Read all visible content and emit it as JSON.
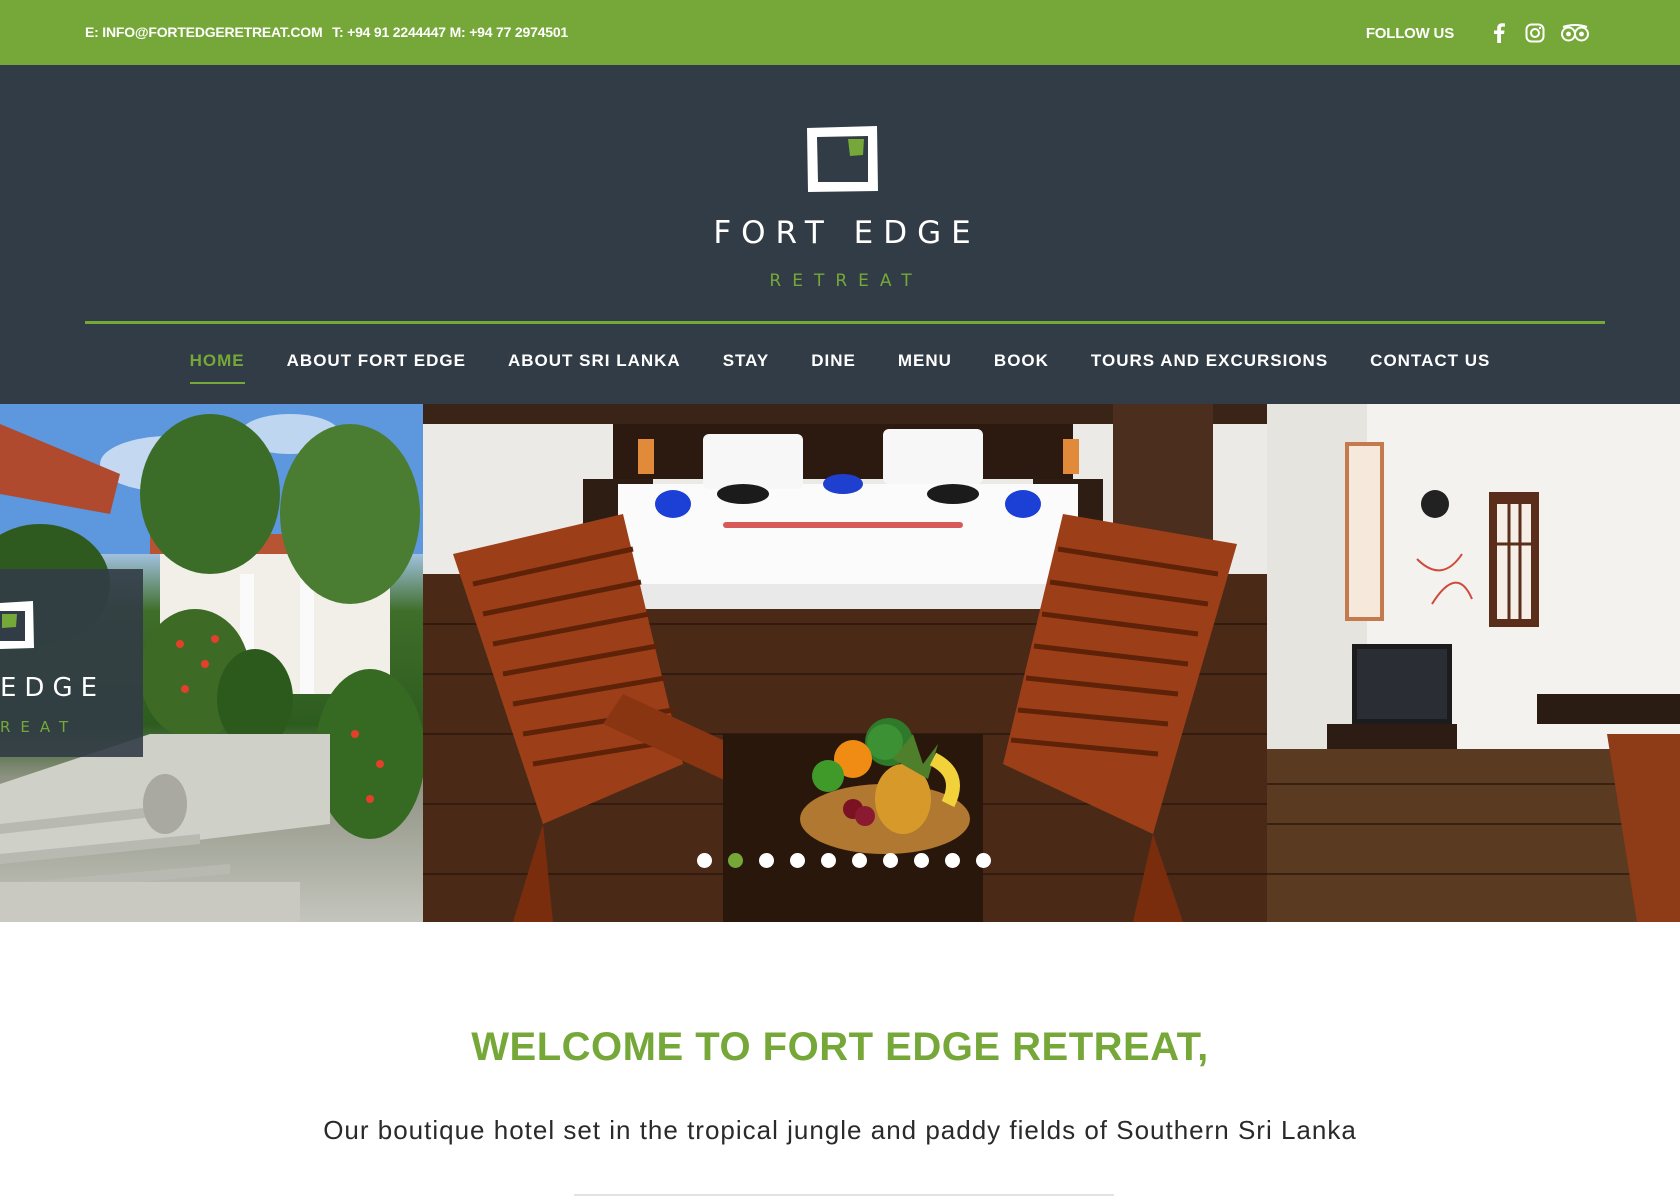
{
  "topbar": {
    "email": "E: INFO@FORTEDGERETREAT.COM",
    "phones": "T: +94 91 2244447 M: +94 77 2974501",
    "follow_label": "FOLLOW US",
    "social_icons": [
      "facebook-icon",
      "instagram-icon",
      "tripadvisor-icon"
    ]
  },
  "brand": {
    "name": "FORT EDGE",
    "sub": "RETREAT"
  },
  "nav": {
    "items": [
      {
        "label": "HOME",
        "active": true
      },
      {
        "label": "ABOUT FORT EDGE"
      },
      {
        "label": "ABOUT SRI LANKA"
      },
      {
        "label": "STAY"
      },
      {
        "label": "DINE"
      },
      {
        "label": "MENU"
      },
      {
        "label": "BOOK"
      },
      {
        "label": "TOURS AND EXCURSIONS"
      },
      {
        "label": "CONTACT US"
      }
    ]
  },
  "slider": {
    "overlay_brand": "EDGE",
    "overlay_sub": "REAT",
    "dot_count": 10,
    "active_dot": 2
  },
  "welcome": {
    "heading": "WELCOME TO FORT EDGE RETREAT,",
    "tagline": "Our boutique hotel set in the tropical jungle and paddy fields of Southern Sri Lanka"
  },
  "colors": {
    "accent": "#76a839",
    "header_bg": "#323c46"
  }
}
